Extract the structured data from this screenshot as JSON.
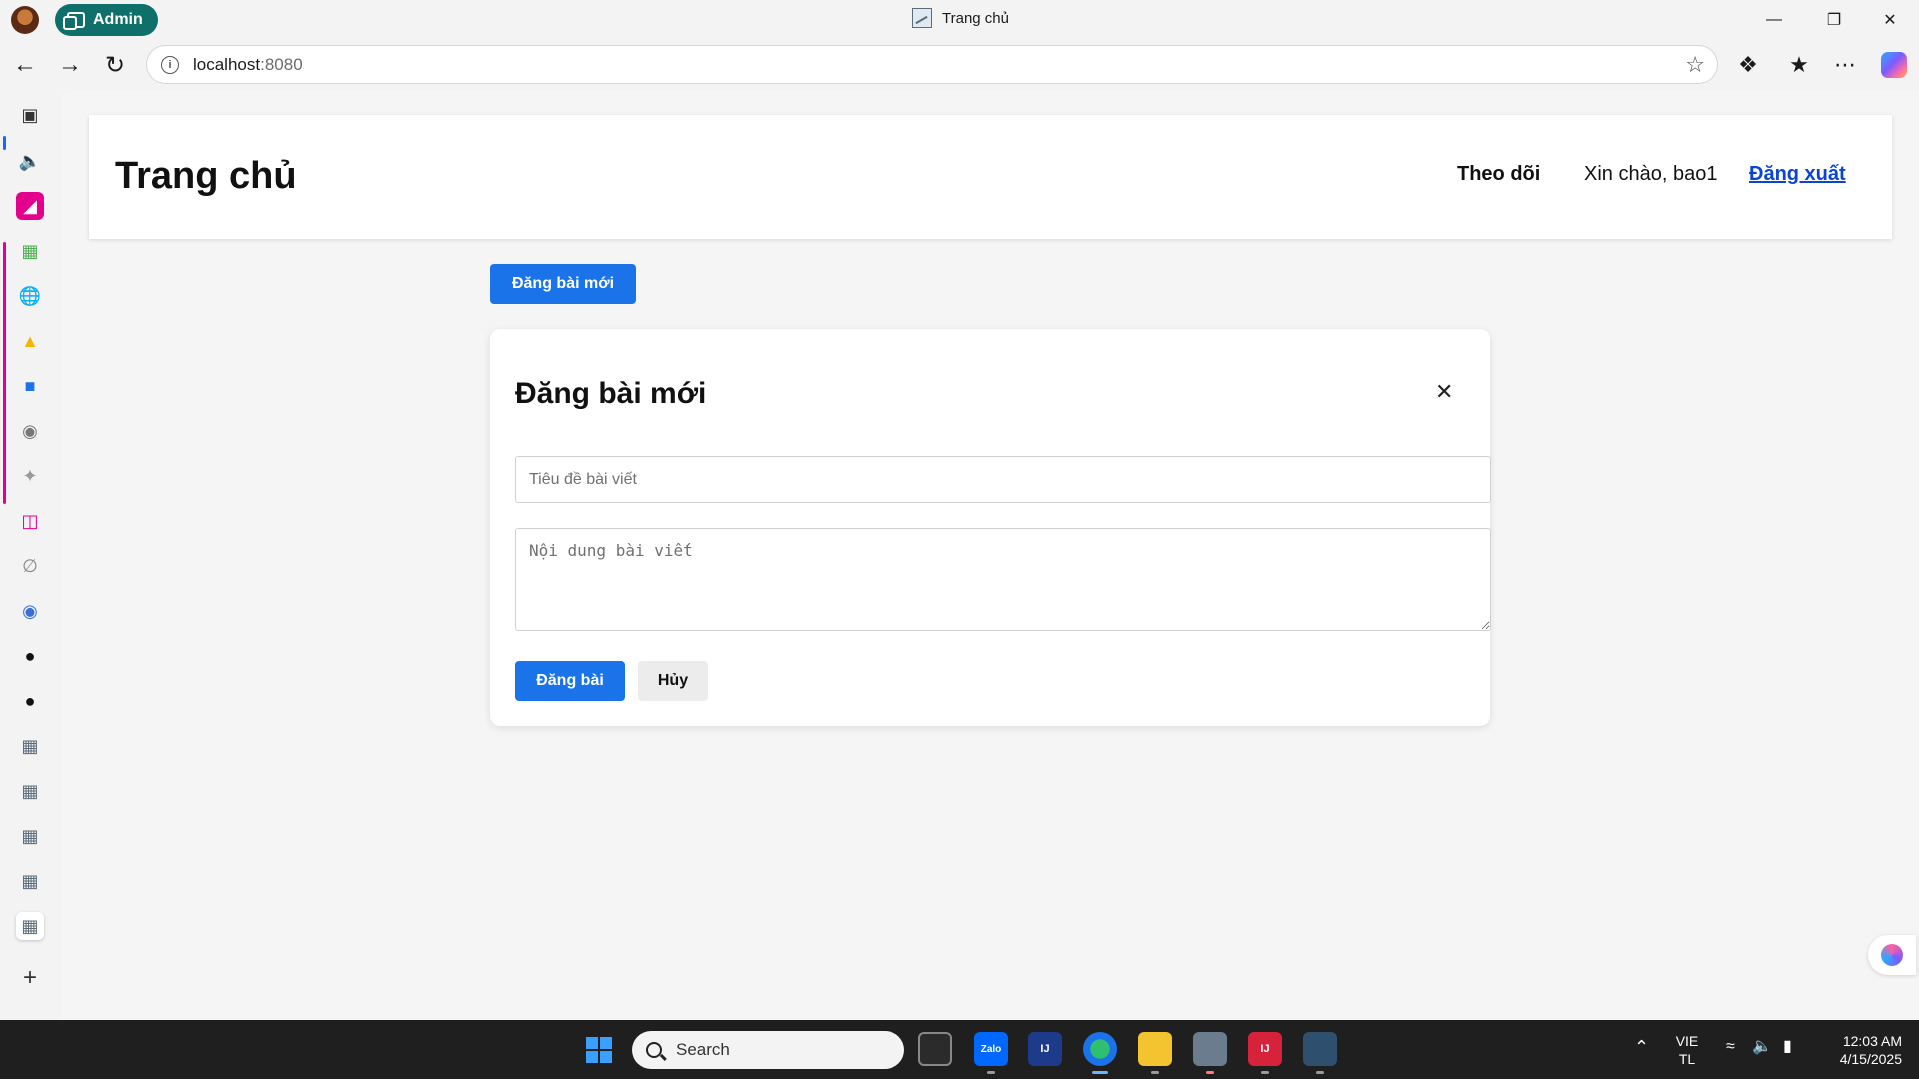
{
  "browser": {
    "profile_label": "Admin",
    "window_title": "Trang chủ",
    "address_host": "localhost",
    "address_port": ":8080"
  },
  "page": {
    "title": "Trang chủ",
    "nav": {
      "follow": "Theo dõi",
      "greeting": "Xin chào, bao1",
      "logout": "Đăng xuất"
    },
    "new_post_button": "Đăng bài mới"
  },
  "modal": {
    "title": "Đăng bài mới",
    "close_glyph": "✕",
    "title_placeholder": "Tiêu đề bài viết",
    "content_placeholder": "Nội dung bài viết",
    "submit": "Đăng bài",
    "cancel": "Hủy"
  },
  "taskbar": {
    "search_label": "Search",
    "language": "VIE",
    "layout": "TL",
    "time": "12:03 AM",
    "date": "4/15/2025"
  },
  "colors": {
    "primary": "#1a73e8",
    "profile_pill": "#0f6f6a",
    "sidebar_accent": "#e3008c",
    "logout_link": "#0a44d4"
  }
}
